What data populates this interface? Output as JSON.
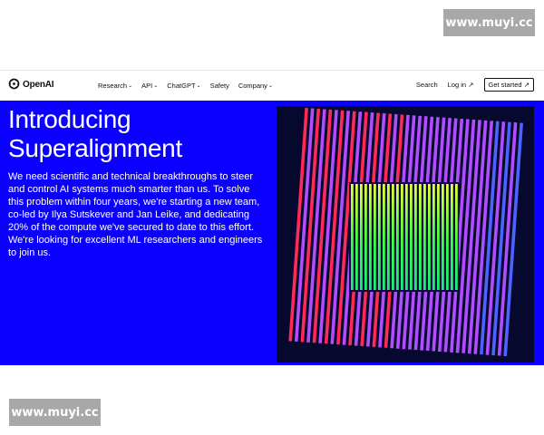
{
  "watermark": {
    "text": "www.muyi.cc"
  },
  "nav": {
    "logo_text": "OpenAI",
    "menu": [
      {
        "label": "Research",
        "has_dropdown": true
      },
      {
        "label": "API",
        "has_dropdown": true
      },
      {
        "label": "ChatGPT",
        "has_dropdown": true
      },
      {
        "label": "Safety",
        "has_dropdown": false
      },
      {
        "label": "Company",
        "has_dropdown": true
      }
    ],
    "search_label": "Search",
    "login_label": "Log in",
    "cta_label": "Get started"
  },
  "hero": {
    "title_line1": "Introducing",
    "title_line2": "Superalignment",
    "description": "We need scientific and technical breakthroughs to steer and control AI systems much smarter than us. To solve this problem within four years, we're starting a new team, co-led by Ilya Sutskever and Jan Leike, and dedicating 20% of the compute we've secured to date to this effort. We're looking for excellent ML researchers and engineers to join us."
  },
  "colors": {
    "hero_bg": "#0b00ff",
    "art_bg": "#07082e",
    "stripe_red": "#ff2a55",
    "stripe_violet": "#b24cff",
    "stripe_blue": "#4d63ff",
    "stripe_green": "#3bff3f",
    "stripe_yellow": "#e8ff3a"
  },
  "icons": {
    "logo": "openai-logo-icon",
    "chevron": "chevron-down-icon",
    "external": "arrow-up-right-icon"
  }
}
